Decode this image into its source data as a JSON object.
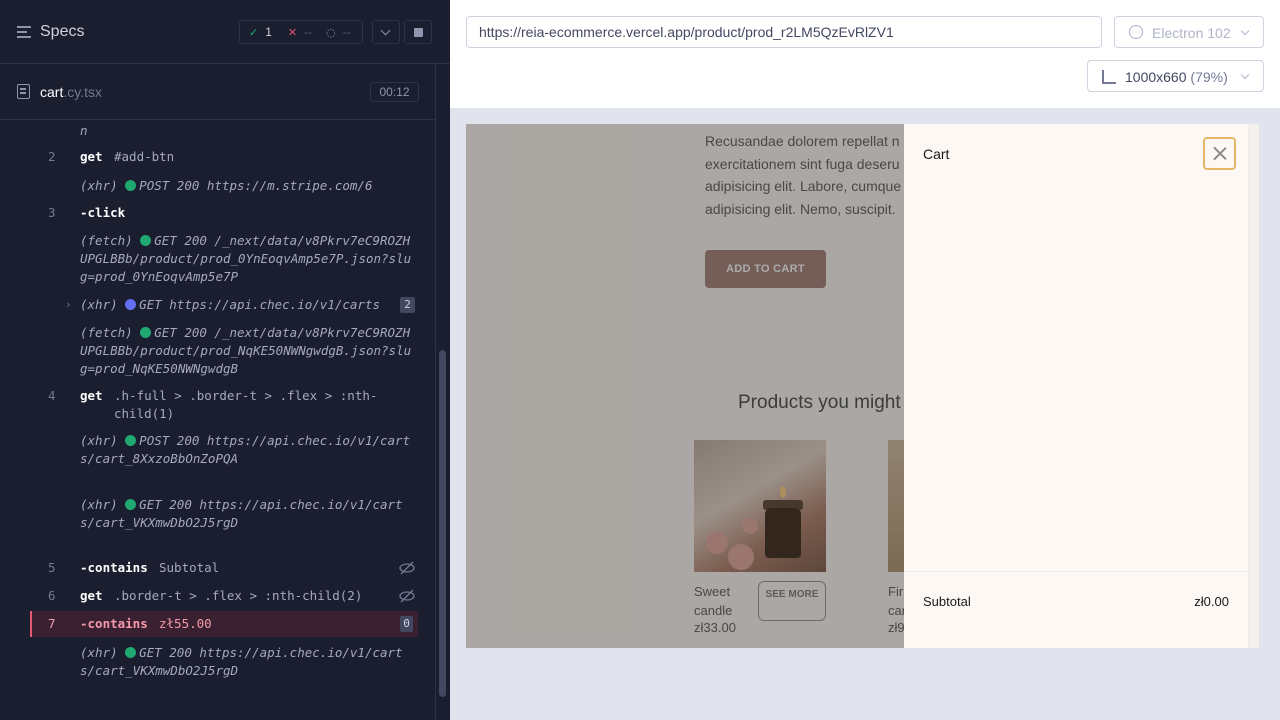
{
  "runner": {
    "title": "Specs",
    "stats": {
      "passed": "1",
      "failed": "--",
      "pending": "--"
    },
    "file": {
      "name": "cart",
      "ext": ".cy.tsx",
      "duration": "00:12"
    },
    "log": {
      "first_line_tail": "n",
      "entries": [
        {
          "num": "2",
          "cmd": "get",
          "arg": "#add-btn"
        },
        {
          "type": "(xhr)",
          "text": "POST 200 https://m.stripe.com/6"
        },
        {
          "num": "3",
          "cmd": "-click"
        },
        {
          "type": "(fetch)",
          "text": "GET 200 /_next/data/v8Pkrv7eC9ROZHUPGLBBb/product/prod_0YnEoqvAmp5e7P.json?slug=prod_0YnEoqvAmp5e7P"
        },
        {
          "type": "(xhr)",
          "text": "GET https://api.chec.io/v1/carts",
          "badge": "2"
        },
        {
          "type": "(fetch)",
          "text": "GET 200 /_next/data/v8Pkrv7eC9ROZHUPGLBBb/product/prod_NqKE50NWNgwdgB.json?slug=prod_NqKE50NWNgwdgB"
        },
        {
          "num": "4",
          "cmd": "get",
          "arg": ".h-full > .border-t > .flex > :nth-child(1)"
        },
        {
          "type": "(xhr)",
          "text": "POST 200 https://api.chec.io/v1/carts/cart_8XxzoBbOnZoPQA"
        },
        {
          "type": "(xhr)",
          "text": "GET 200 https://api.chec.io/v1/carts/cart_VKXmwDbO2J5rgD"
        },
        {
          "num": "5",
          "cmd": "-contains",
          "arg": "Subtotal"
        },
        {
          "num": "6",
          "cmd": "get",
          "arg": ".border-t > .flex > :nth-child(2)"
        },
        {
          "num": "7",
          "cmd": "-contains",
          "arg": "zł55.00",
          "badge": "0"
        },
        {
          "type": "(xhr)",
          "text": "GET 200 https://api.chec.io/v1/carts/cart_VKXmwDbO2J5rgD"
        }
      ]
    }
  },
  "aut": {
    "url": "https://reia-ecommerce.vercel.app/product/prod_r2LM5QzEvRlZV1",
    "browser": "Electron 102",
    "viewport": "1000x660",
    "zoom": "(79%)"
  },
  "page": {
    "description": "Recusandae dolorem repellat n\nexercitationem sint fuga deseru\nadipisicing elit. Labore, cumque\nadipisicing elit. Nemo, suscipit.",
    "add_to_cart": "ADD TO CART",
    "also_title": "Products you might",
    "cards": [
      {
        "name": "Sweet candle",
        "price": "zł33.00",
        "more": "SEE MORE"
      },
      {
        "name": "Fir car",
        "price": "zł9"
      }
    ]
  },
  "cart": {
    "title": "Cart",
    "subtotal_label": "Subtotal",
    "subtotal_value": "zł0.00"
  }
}
